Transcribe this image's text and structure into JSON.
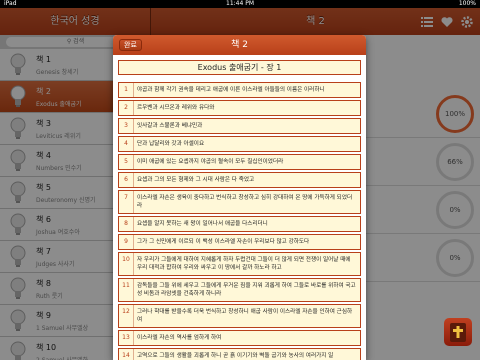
{
  "status": {
    "time": "11:44 PM",
    "carrier": "iPad",
    "battery": "100%"
  },
  "sidebar": {
    "title": "한국어 성경",
    "search_placeholder": "검색",
    "items": [
      {
        "label": "책 1",
        "sub": "Genesis 창세기"
      },
      {
        "label": "책 2",
        "sub": "Exodus 출애굽기"
      },
      {
        "label": "책 3",
        "sub": "Leviticus 레위기"
      },
      {
        "label": "책 4",
        "sub": "Numbers 민수기"
      },
      {
        "label": "책 5",
        "sub": "Deuteronomy 신명기"
      },
      {
        "label": "책 6",
        "sub": "Joshua 여호수아"
      },
      {
        "label": "책 7",
        "sub": "Judges 사사기"
      },
      {
        "label": "책 8",
        "sub": "Ruth 룻기"
      },
      {
        "label": "책 9",
        "sub": "1 Samuel 사무엘상"
      },
      {
        "label": "책 10",
        "sub": "2 Samuel 사무엘하"
      }
    ]
  },
  "main": {
    "title": "책 2",
    "percents": [
      "100%",
      "66%",
      "0%",
      "0%"
    ]
  },
  "modal": {
    "done_label": "완료",
    "title": "책 2",
    "chapter_title": "Exodus 출애굽기 - 장 1",
    "verses": [
      {
        "n": "1",
        "t": "야곱과 함께 각기 권속을 데리고 애굽에 이른 이스라엘 아들들의 이름은 이러하니"
      },
      {
        "n": "2",
        "t": "르우벤과 시므온과 레위와 유다와"
      },
      {
        "n": "3",
        "t": "잇사갈과 스불론과 베냐민과"
      },
      {
        "n": "4",
        "t": "단과 납달리와 갓과 아셀이요"
      },
      {
        "n": "5",
        "t": "이미 애굽에 있는 요셉까지 야곱의 혈속이 모두 칠십인이었더라"
      },
      {
        "n": "6",
        "t": "요셉과 그의 모든 형제와 그 시대 사람은 다 죽었고"
      },
      {
        "n": "7",
        "t": "이스라엘 자손은 생육이 중다하고 번식하고 창성하고 심히 강대하여 온 땅에 가득하게 되었더라"
      },
      {
        "n": "8",
        "t": "요셉을 알지 못하는 새 왕이 일어나서 애굽을 다스리더니"
      },
      {
        "n": "9",
        "t": "그가 그 신민에게 이르되 이 백성 이스라엘 자손이 우리보다 많고 강하도다"
      },
      {
        "n": "10",
        "t": "자 우리가 그들에게 대하여 지혜롭게 하자 두렵건대 그들이 더 많게 되면 전쟁이 일어날 때에 우리 대적과 합하여 우리와 싸우고 이 땅에서 갈까 하노라 하고"
      },
      {
        "n": "11",
        "t": "감독들을 그들 위에 세우고 그들에게 무거운 짐을 지워 괴롭게 하여 그들로 바로를 위하여 국고성 비돔과 라암셋을 건축하게 하니라"
      },
      {
        "n": "12",
        "t": "그러나 학대를 받을수록 더욱 번식하고 창성하니 애굽 사람이 이스라엘 자손을 인하여 근심하여"
      },
      {
        "n": "13",
        "t": "이스라엘 자손의 역사를 엄하게 하여"
      },
      {
        "n": "14",
        "t": "고역으로 그들의 생활을 괴롭게 하니 곧 흙 이기기와 벽돌 굽기와 농사의 여러가지 일"
      }
    ]
  },
  "colors": {
    "accent": "#b8401a",
    "verse_bg": "#fff8d8"
  }
}
